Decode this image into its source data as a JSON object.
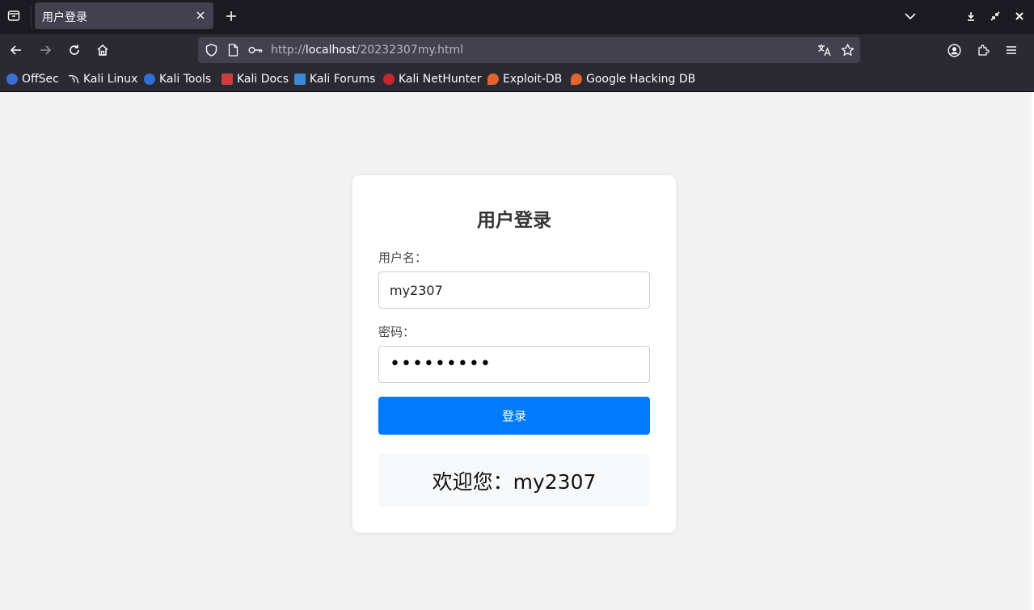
{
  "browser": {
    "tab": {
      "title": "用户登录"
    },
    "url": {
      "prefix": "http://",
      "host": "localhost",
      "path": "/20232307my.html"
    },
    "bookmarks": [
      {
        "label": "OffSec",
        "color": "#3b6fd8"
      },
      {
        "label": "Kali Linux",
        "color": "#5a5a5a"
      },
      {
        "label": "Kali Tools",
        "color": "#2f6fd6"
      },
      {
        "label": "Kali Docs",
        "color": "#d23b3b"
      },
      {
        "label": "Kali Forums",
        "color": "#3b8ad8"
      },
      {
        "label": "Kali NetHunter",
        "color": "#c8262f"
      },
      {
        "label": "Exploit-DB",
        "color": "#e2662b"
      },
      {
        "label": "Google Hacking DB",
        "color": "#e2662b"
      }
    ]
  },
  "login": {
    "title": "用户登录",
    "username_label": "用户名：",
    "username_value": "my2307",
    "password_label": "密码：",
    "password_value": "•••••••••",
    "submit_label": "登录",
    "welcome_text": "欢迎您：my2307"
  },
  "colors": {
    "primary_button": "#007bff",
    "tab_strip": "#1c1b22",
    "toolbar": "#2b2a33"
  }
}
